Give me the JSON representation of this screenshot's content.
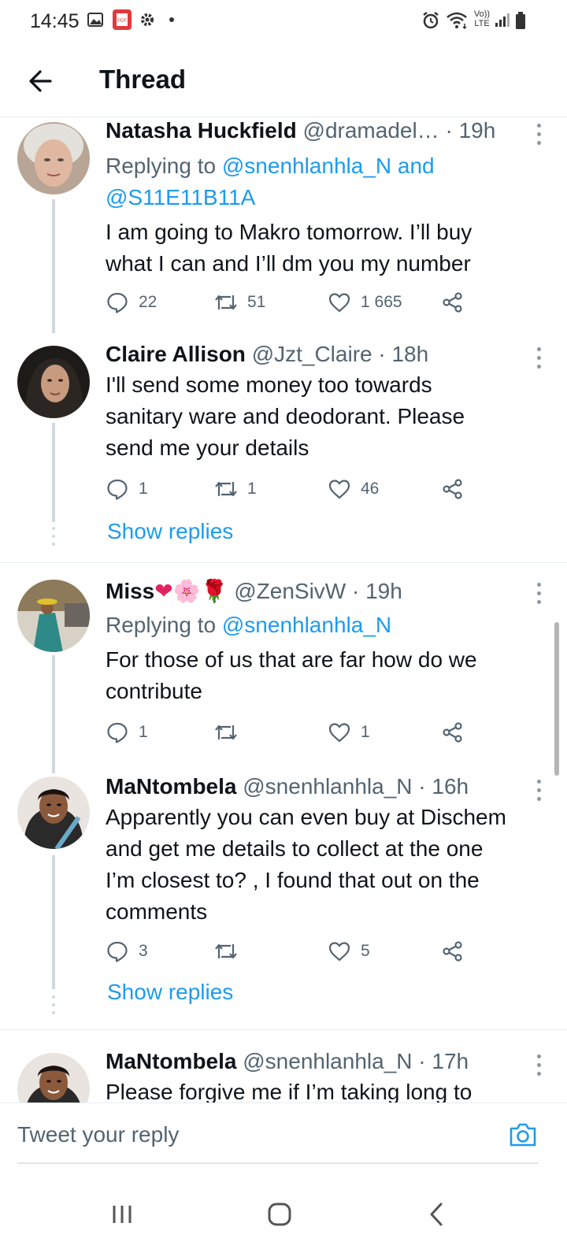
{
  "status": {
    "time": "14:45",
    "network": "Vo)) LTE"
  },
  "header": {
    "title": "Thread"
  },
  "tweets": [
    {
      "name": "Natasha Huckfield",
      "handle": "@dramadel…",
      "time": "19h",
      "replying_prefix": "Replying to",
      "replying_to": "@snenhlanhla_N and",
      "replying_to_2": "@S11E11B11A",
      "text_lines": [
        "I am going to Makro tomorrow. I’ll buy",
        "what I can and I’ll dm you my number"
      ],
      "replies": "22",
      "retweets": "51",
      "likes": "1 665"
    },
    {
      "name": "Claire Allison",
      "handle": "@Jzt_Claire",
      "time": "18h",
      "text_lines": [
        "I'll send some money too towards",
        "sanitary ware and deodorant. Please",
        "send me your details"
      ],
      "replies": "1",
      "retweets": "1",
      "likes": "46"
    },
    {
      "name": "Miss",
      "name_emoji": "❤🌸🌹",
      "handle": "@ZenSivW",
      "time": "19h",
      "replying_prefix": "Replying to",
      "replying_to": "@snenhlanhla_N",
      "text_lines": [
        "For those of us that are far how do we",
        "contribute"
      ],
      "replies": "1",
      "retweets": "",
      "likes": "1"
    },
    {
      "name": "MaNtombela",
      "handle": "@snenhlanhla_N",
      "time": "16h",
      "text_lines": [
        "Apparently you can even buy at Dischem",
        "and get me details to collect at the one",
        "I’m closest to? , I found that out on the",
        "comments"
      ],
      "replies": "3",
      "retweets": "",
      "likes": "5"
    },
    {
      "name": "MaNtombela",
      "handle": "@snenhlanhla_N",
      "time": "17h",
      "text_lines": [
        "Please forgive me if I’m taking long to"
      ]
    }
  ],
  "show_replies_label": "Show replies",
  "composer": {
    "placeholder": "Tweet your reply"
  },
  "colors": {
    "accent": "#1d9bf0",
    "secondary_text": "#536471",
    "like_heart": "#e0245e"
  },
  "icons": [
    "back-arrow-icon",
    "reply-icon",
    "retweet-icon",
    "like-icon",
    "share-icon",
    "more-icon",
    "camera-icon",
    "recents-icon",
    "home-icon",
    "back-nav-icon"
  ]
}
